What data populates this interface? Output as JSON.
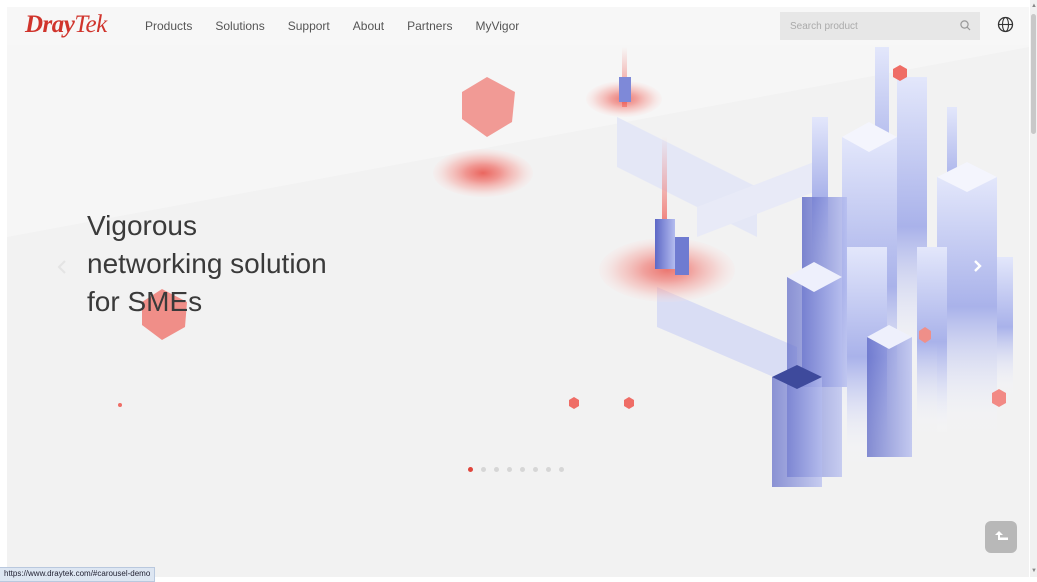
{
  "brand": {
    "part1": "Dray",
    "part2": "Tek",
    "color": "#d0342c"
  },
  "nav": {
    "items": [
      "Products",
      "Solutions",
      "Support",
      "About",
      "Partners",
      "MyVigor"
    ]
  },
  "search": {
    "placeholder": "Search product",
    "icon": "search-icon"
  },
  "language": {
    "icon": "globe-icon"
  },
  "hero": {
    "lines": [
      "Vigorous",
      "networking solution",
      "for SMEs"
    ],
    "prev_icon": "chevron-left-icon",
    "next_icon": "chevron-right-icon",
    "slide_count": 8,
    "active_slide": 1
  },
  "back_to_top": {
    "icon": "arrow-up-icon"
  },
  "status_bar": {
    "url": "https://www.draytek.com/#carousel-demo"
  },
  "colors": {
    "accent": "#e0453c",
    "building": "#7d88d8",
    "background": "#f6f6f6"
  }
}
